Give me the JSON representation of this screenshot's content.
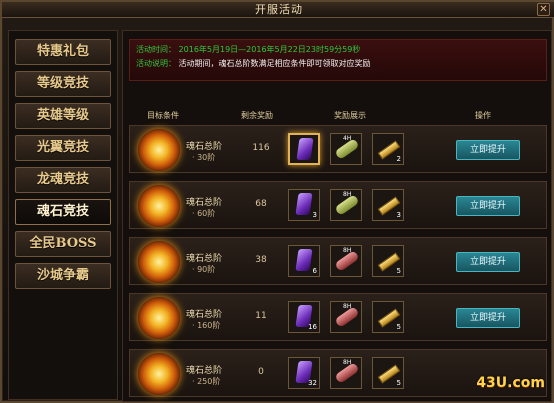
{
  "window": {
    "title": "开服活动",
    "close_glyph": "✕"
  },
  "sidebar": {
    "items": [
      {
        "label": "特惠礼包",
        "active": false
      },
      {
        "label": "等级竞技",
        "active": false
      },
      {
        "label": "英雄等级",
        "active": false
      },
      {
        "label": "光翼竞技",
        "active": false
      },
      {
        "label": "龙魂竞技",
        "active": false
      },
      {
        "label": "魂石竞技",
        "active": true
      },
      {
        "label": "全民BOSS",
        "active": false
      },
      {
        "label": "沙城争霸",
        "active": false
      }
    ]
  },
  "info": {
    "time_label": "活动时间：",
    "time_value": "2016年5月19日—2016年5月22日23时59分59秒",
    "desc_label": "活动说明：",
    "desc_value": "活动期间，魂石总阶数满足相应条件即可领取对应奖励"
  },
  "table": {
    "headers": [
      "目标条件",
      "剩余奖励",
      "奖励展示",
      "操作"
    ],
    "rows": [
      {
        "title": "魂石总阶",
        "sub": "· 30阶",
        "remaining": "116",
        "gem_qty": "",
        "scroll_tag": "4H",
        "scroll_color": "green",
        "bar_qty": "2",
        "button": "立即提升"
      },
      {
        "title": "魂石总阶",
        "sub": "· 60阶",
        "remaining": "68",
        "gem_qty": "3",
        "scroll_tag": "8H",
        "scroll_color": "green",
        "bar_qty": "3",
        "button": "立即提升"
      },
      {
        "title": "魂石总阶",
        "sub": "· 90阶",
        "remaining": "38",
        "gem_qty": "6",
        "scroll_tag": "8H",
        "scroll_color": "red",
        "bar_qty": "5",
        "button": "立即提升"
      },
      {
        "title": "魂石总阶",
        "sub": "· 160阶",
        "remaining": "11",
        "gem_qty": "16",
        "scroll_tag": "8H",
        "scroll_color": "red",
        "bar_qty": "5",
        "button": "立即提升"
      },
      {
        "title": "魂石总阶",
        "sub": "· 250阶",
        "remaining": "0",
        "gem_qty": "32",
        "scroll_tag": "8H",
        "scroll_color": "red",
        "bar_qty": "5",
        "button": ""
      }
    ]
  },
  "watermark": {
    "text": "43U.com"
  },
  "icons": {
    "emblem": "soulstone-emblem-icon",
    "gem": "purple-crystal-icon",
    "scroll": "scroll-icon",
    "bar": "gold-bar-icon"
  }
}
